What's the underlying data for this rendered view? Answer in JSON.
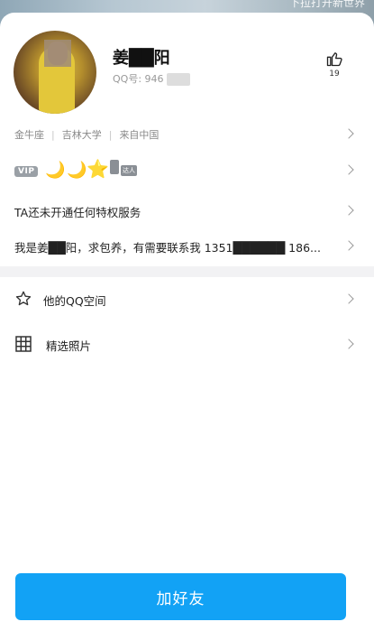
{
  "background": {
    "hint_text": "下拉打开新世界"
  },
  "profile": {
    "name": "姜██阳",
    "qq_label": "QQ号: 946",
    "like_count": "19"
  },
  "tags": [
    "金牛座",
    "吉林大学",
    "来自中国"
  ],
  "badges": {
    "vip": "VIP",
    "daren": "达人"
  },
  "privilege_text": "TA还未开通任何特权服务",
  "signature": "我是姜██阳，求包养，有需要联系我 1351██████ 186...",
  "menu": [
    {
      "label": "他的QQ空间",
      "icon": "qzone-star-icon"
    },
    {
      "label": "精选照片",
      "icon": "grid-icon"
    }
  ],
  "action": {
    "add_friend_label": "加好友"
  },
  "colors": {
    "primary": "#12a2f5",
    "star": "#f7b500"
  }
}
